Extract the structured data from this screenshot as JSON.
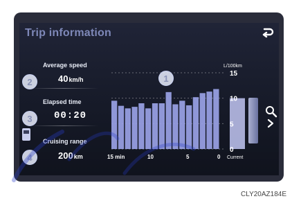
{
  "screen": {
    "title": "Trip information",
    "back_icon": "return-arrow-icon"
  },
  "metrics": {
    "average_speed": {
      "label": "Average speed",
      "value": "40",
      "unit": "km/h"
    },
    "elapsed_time": {
      "label": "Elapsed time",
      "value": "00:20"
    },
    "cruising_range": {
      "label": "Cruising range",
      "value": "200",
      "unit": "km"
    }
  },
  "callouts": [
    "2",
    "3",
    "4",
    "1"
  ],
  "caption": "CLY20AZ184E",
  "chart_data": {
    "type": "bar",
    "unit_label": "L/100km",
    "y_ticks": [
      "0",
      "5",
      "10",
      "15"
    ],
    "ylim": [
      0,
      15
    ],
    "x_tick_labels": [
      "15 min",
      "10",
      "5",
      "0"
    ],
    "history_values": [
      9.5,
      8.5,
      8.0,
      8.3,
      9.0,
      8.0,
      9.0,
      9.0,
      11.2,
      8.8,
      9.5,
      8.6,
      10.2,
      11.0,
      11.3,
      11.8
    ],
    "current_label": "Current",
    "current_value": 10.0,
    "bar_color": "#9aa2e6",
    "accent_color": "#7e88b8"
  }
}
